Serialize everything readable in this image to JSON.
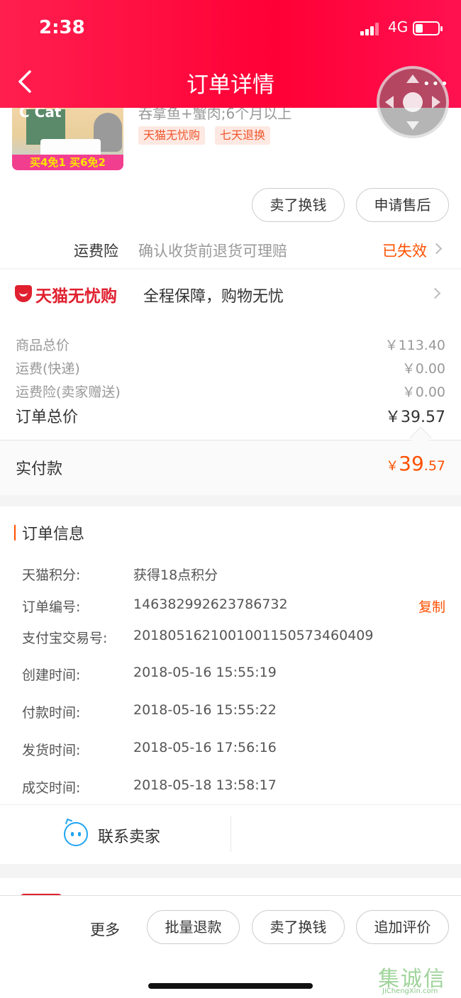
{
  "status_bar": {
    "time": "2:38",
    "network": "4G"
  },
  "header": {
    "title": "订单详情"
  },
  "product": {
    "image_brand": "C Cat",
    "image_promo": "买4免1 买6免2",
    "spec": "吞拿鱼+蟹肉;6个月以上",
    "tags": [
      "天猫无忧购",
      "七天退换"
    ]
  },
  "actions": {
    "sell_label": "卖了换钱",
    "aftersale_label": "申请售后"
  },
  "shipping_insurance": {
    "label": "运费险",
    "desc": "确认收货前退货可理赔",
    "status": "已失效"
  },
  "worry_free": {
    "brand": "天猫无忧购",
    "desc": "全程保障，购物无忧"
  },
  "prices": {
    "rows": [
      {
        "label": "商品总价",
        "value": "￥113.40"
      },
      {
        "label": "运费(快递)",
        "value": "￥0.00"
      },
      {
        "label": "运费险(卖家赠送)",
        "value": "￥0.00"
      }
    ],
    "total_label": "订单总价",
    "total_value": "￥39.57",
    "paid_label": "实付款",
    "paid_currency": "￥",
    "paid_int": "39",
    "paid_dec": ".57"
  },
  "order_info": {
    "title": "订单信息",
    "rows": [
      {
        "label": "天猫积分:",
        "value": "获得18点积分"
      },
      {
        "label": "订单编号:",
        "value": "146382992623786732"
      },
      {
        "label": "支付宝交易号:",
        "value": "2018051621001001150573460409"
      },
      {
        "label": "创建时间:",
        "value": "2018-05-16 15:55:19"
      },
      {
        "label": "付款时间:",
        "value": "2018-05-16 15:55:22"
      },
      {
        "label": "发货时间:",
        "value": "2018-05-16 17:56:16"
      },
      {
        "label": "成交时间:",
        "value": "2018-05-18 13:58:17"
      }
    ],
    "copy_label": "复制"
  },
  "contact": {
    "label": "联系卖家"
  },
  "bottom_bar": {
    "more_label": "更多",
    "buttons": [
      "批量退款",
      "卖了换钱",
      "追加评价"
    ]
  },
  "watermark": {
    "chars": "集诚信",
    "sub": "JiChengXin.com"
  },
  "colors": {
    "brand_red": "#ff0036",
    "accent_orange": "#ff5000",
    "tag_bg": "#fde8e2"
  }
}
